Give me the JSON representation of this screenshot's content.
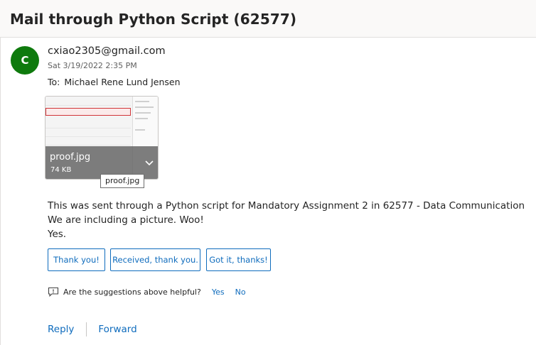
{
  "subject": "Mail through Python Script (62577)",
  "sender": {
    "initial": "C",
    "email": "cxiao2305@gmail.com",
    "date": "Sat 3/19/2022 2:35 PM",
    "avatar_color": "#0e7a0d"
  },
  "recipient": {
    "label": "To:",
    "name": "Michael Rene Lund Jensen"
  },
  "attachment": {
    "name": "proof.jpg",
    "size": "74 KB",
    "tooltip": "proof.jpg",
    "icon": "chevron-down-icon"
  },
  "body_lines": [
    "This was sent through a Python script for Mandatory Assignment 2 in 62577 - Data Communication",
    "We are including a picture. Woo!",
    "Yes."
  ],
  "suggested_replies": [
    "Thank you!",
    "Received, thank you.",
    "Got it, thanks!"
  ],
  "feedback": {
    "question": "Are the suggestions above helpful?",
    "yes": "Yes",
    "no": "No",
    "icon": "feedback-icon"
  },
  "actions": {
    "reply": "Reply",
    "forward": "Forward"
  },
  "colors": {
    "accent": "#0f6cbd",
    "background": "#faf9f8"
  }
}
